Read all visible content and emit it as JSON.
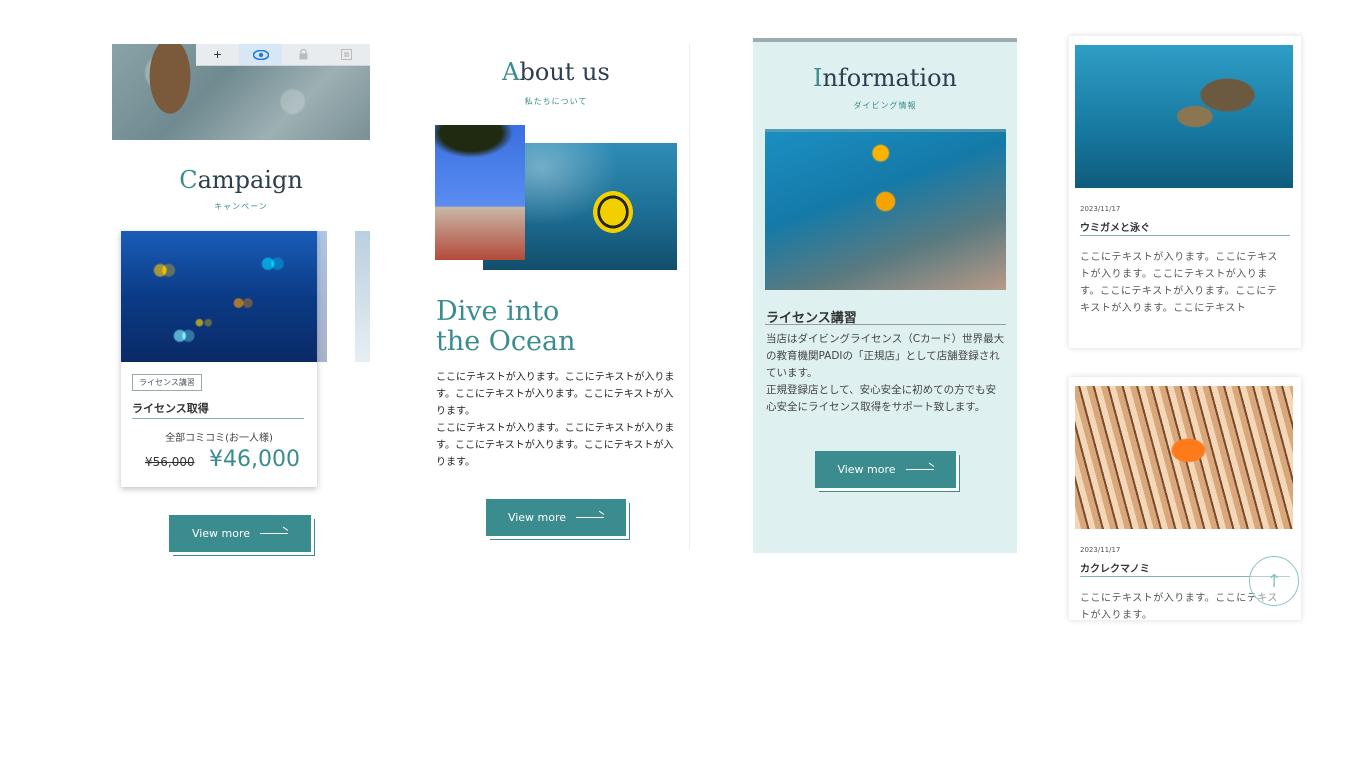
{
  "toolbar": {
    "icons": [
      "plus-icon",
      "eye-icon",
      "lock-icon",
      "image-icon"
    ],
    "plus": "+",
    "eye": "👁",
    "lock": "🔒",
    "frame": "▣"
  },
  "campaign": {
    "title_cap": "C",
    "title_rest": "ampaign",
    "subtitle": "キャンペーン",
    "card": {
      "tag": "ライセンス講習",
      "name": "ライセンス取得",
      "plan": "全部コミコミ(お一人様)",
      "old_price": "¥56,000",
      "new_price": "¥46,000"
    },
    "button": "View more"
  },
  "about": {
    "title_cap": "A",
    "title_rest": "bout us",
    "subtitle": "私たちについて",
    "headline_1": "Dive into",
    "headline_2": "the Ocean",
    "body": "ここにテキストが入ります。ここにテキストが入ります。ここにテキストが入ります。ここにテキストが入ります。\nここにテキストが入ります。ここにテキストが入ります。ここにテキストが入ります。ここにテキストが入ります。",
    "button": "View more"
  },
  "information": {
    "title_cap": "I",
    "title_rest": "nformation",
    "subtitle": "ダイビング情報",
    "heading": "ライセンス講習",
    "body": "当店はダイビングライセンス（Cカード）世界最大の教育機関PADIの「正規店」として店舗登録されています。\n正規登録店として、安心安全に初めての方でも安心安全にライセンス取得をサポート致します。",
    "button": "View more"
  },
  "news": [
    {
      "date": "2023/11/17",
      "title": "ウミガメと泳ぐ",
      "body": "ここにテキストが入ります。ここにテキストが入ります。ここにテキストが入ります。ここにテキストが入ります。ここにテキストが入ります。ここにテキスト"
    },
    {
      "date": "2023/11/17",
      "title": "カクレクマノミ",
      "body": "ここにテキストが入ります。ここにテキストが入ります。"
    }
  ],
  "scroll_top": {
    "icon": "arrow-up-icon",
    "glyph": "↑"
  }
}
